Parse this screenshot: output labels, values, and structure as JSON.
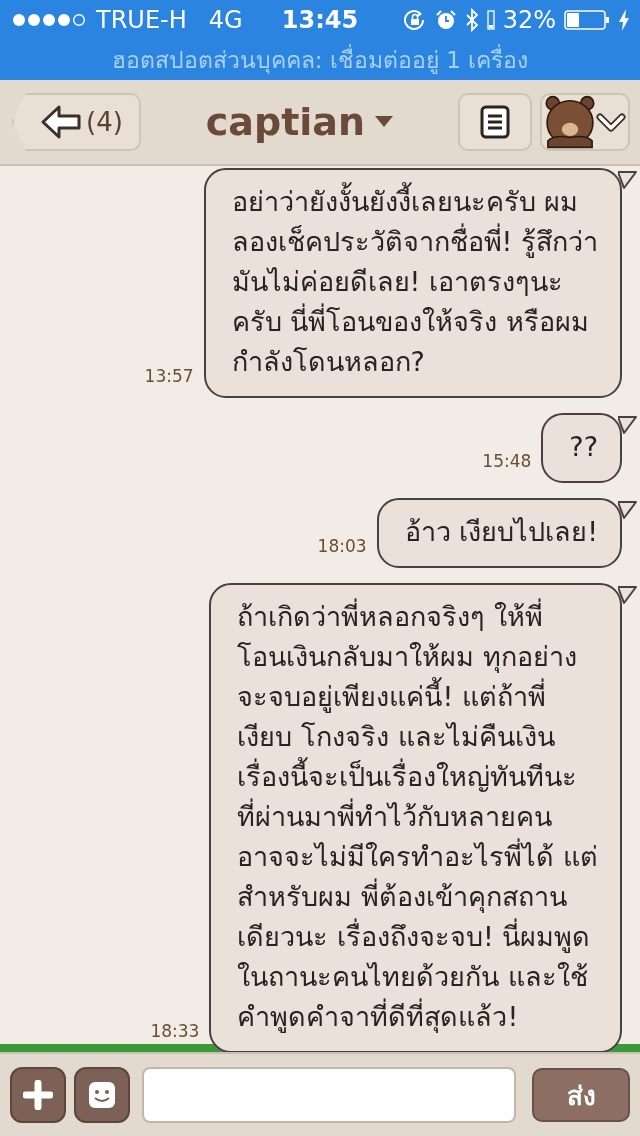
{
  "status_bar": {
    "carrier": "TRUE-H",
    "network": "4G",
    "time": "13:45",
    "battery": "32%"
  },
  "hotspot_banner": "ฮอตสปอตส่วนบุคคล: เชื่อมต่ออยู่ 1 เครื่อง",
  "nav": {
    "back_count": "(4)",
    "title": "captian"
  },
  "messages": [
    {
      "time": "13:57",
      "text": "อย่าว่ายังงั้นยังงี้เลยนะครับ ผม\nลองเช็คประวัติจากชื่อพี่! รู้สึกว่า\nมันไม่ค่อยดีเลย!  เอาตรงๆนะ\nครับ นี่พี่โอนของให้จริง หรือผม\nกำลังโดนหลอก?"
    },
    {
      "time": "15:48",
      "text": "??"
    },
    {
      "time": "18:03",
      "text": "อ้าว เงียบไปเลย!"
    },
    {
      "time": "18:33",
      "text": "ถ้าเกิดว่าพี่หลอกจริงๆ ให้พี่\nโอนเงินกลับมาให้ผม ทุกอย่าง\nจะจบอยู่เพียงแค่นี้! แต่ถ้าพี่\nเงียบ โกงจริง และไม่คืนเงิน\nเรื่องนี้จะเป็นเรื่องใหญ่ทันทีนะ\nที่ผ่านมาพี่ทำไว้กับหลายคน\nอาจจะไม่มีใครทำอะไรพี่ได้ แต่\nสำหรับผม พี่ต้องเข้าคุกสถาน\nเดียวนะ เรื่องถึงจะจบ! นี่ผมพูด\nในถานะคนไทยด้วยกัน และใช้\nคำพูดคำจาที่ดีที่สุดแล้ว!"
    }
  ],
  "composer": {
    "send": "ส่ง"
  }
}
